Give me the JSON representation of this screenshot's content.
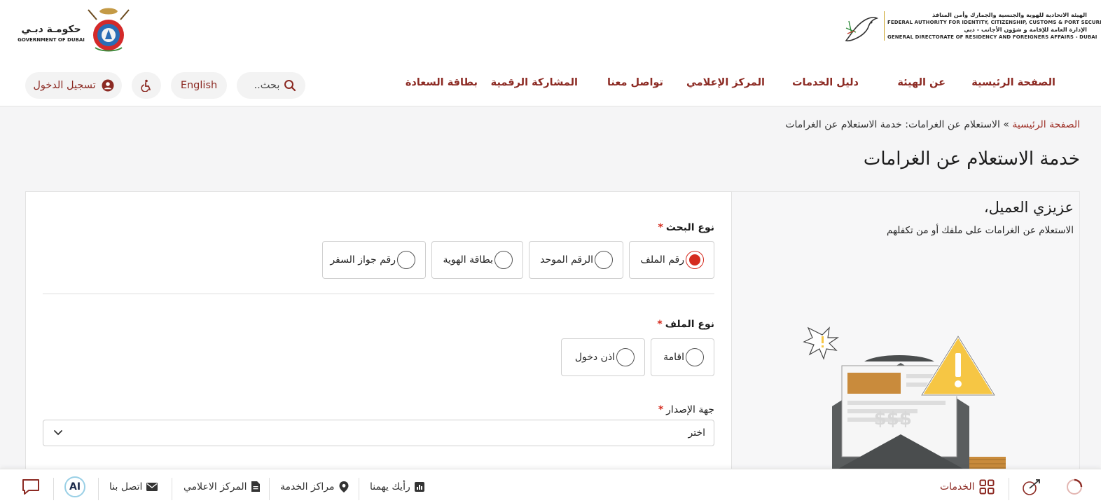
{
  "header": {
    "fed_logo": {
      "line1_ar": "الهيئة الاتحادية للهوية والجنسية والجمارك وأمن المنافذ",
      "line2_en": "FEDERAL AUTHORITY FOR IDENTITY, CITIZENSHIP, CUSTOMS & PORT SECURITY",
      "line3_ar": "الإدارة العامة للإقامة و شؤون الأجانب - دبي",
      "line4_en": "GENERAL DIRECTORATE OF RESIDENCY AND FOREIGNERS AFFAIRS - DUBAI"
    },
    "dubai_logo": {
      "ar": "حكومـة دبـي",
      "en": "GOVERNMENT OF DUBAI"
    },
    "nav": [
      "الصفحة الرئيسية",
      "عن الهيئة",
      "دليل الخدمات",
      "المركز الإعلامي",
      "تواصل معنا",
      "المشاركة الرقمية",
      "بطاقة السعادة"
    ],
    "search_label": "بحث..",
    "language_label": "English",
    "login_label": "تسجيل الدخول"
  },
  "breadcrumb": {
    "home": "الصفحة الرئيسية",
    "separator": " » ",
    "current": "الاستعلام عن الغرامات: خدمة الاستعلام عن الغرامات"
  },
  "page_title": "خدمة الاستعلام عن الغرامات",
  "info": {
    "greeting": "عزيزي العميل،",
    "description": "الاستعلام عن الغرامات على ملفك أو من تكفلهم"
  },
  "form": {
    "search_type": {
      "label": "نوع البحث",
      "required_mark": "*",
      "options": [
        "رقم الملف",
        "الرقم الموحد",
        "بطاقة الهوية",
        "رقم جواز السفر"
      ],
      "selected": "رقم الملف"
    },
    "file_type": {
      "label": "نوع الملف",
      "required_mark": "*",
      "options": [
        "اقامة",
        "اذن دخول"
      ]
    },
    "issuer": {
      "label": "جهة الإصدار",
      "required_mark": "*",
      "selected_value": "اختر"
    }
  },
  "bottom_bar": {
    "services": "الخدمات",
    "feedback": "رأيك يهمنا",
    "service_centers": "مراكز الخدمة",
    "media_center": "المركز الاعلامي",
    "contact_us": "اتصل بنا",
    "ai_badge": "AI"
  },
  "colors": {
    "brand_red": "#8c2a23",
    "required_red": "#d52b1e",
    "warning_yellow": "#f6c644"
  }
}
